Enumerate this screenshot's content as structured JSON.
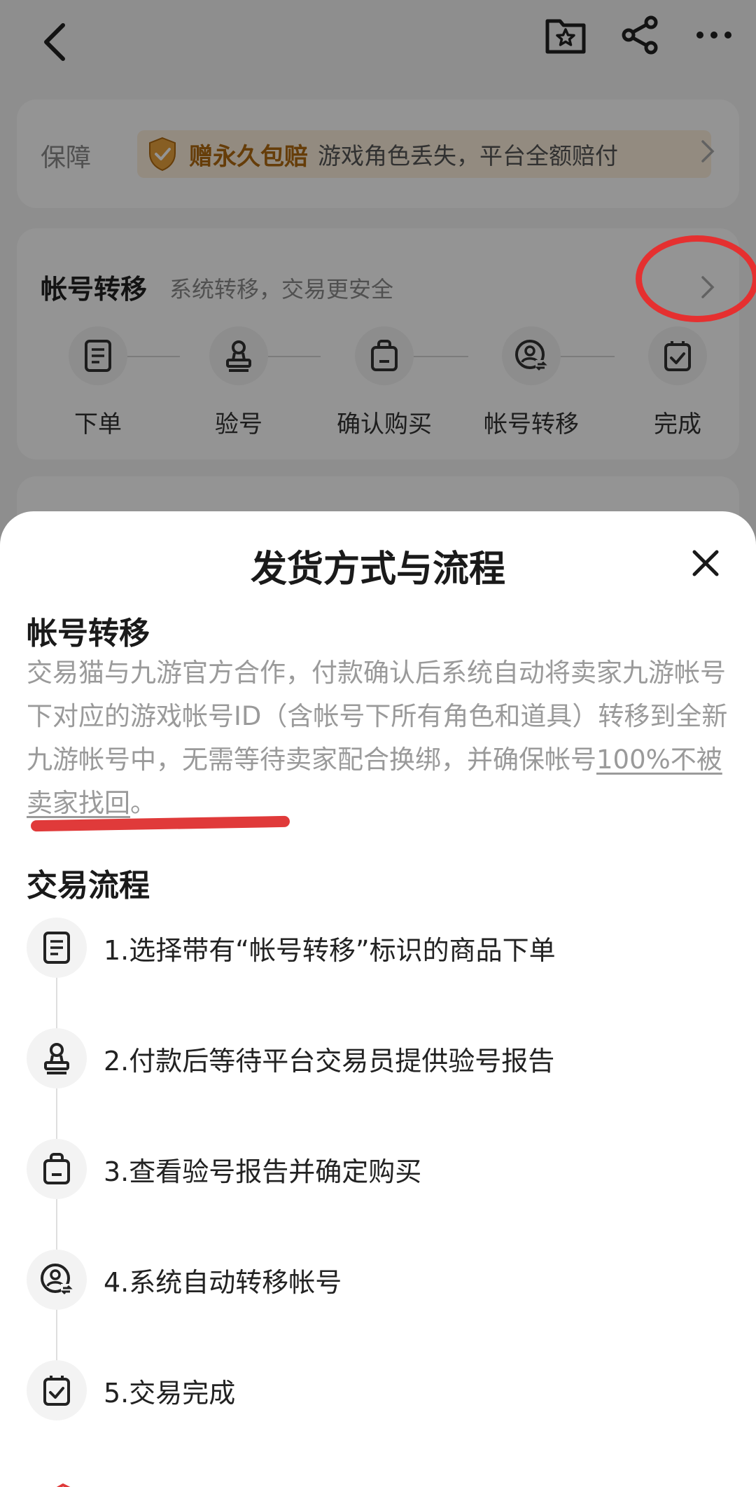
{
  "background": {
    "guarantee": {
      "label": "保障",
      "badge": "赠永久包赔",
      "description": "游戏角色丢失，平台全额赔付"
    },
    "transfer": {
      "title": "帐号转移",
      "subtitle": "系统转移，交易更安全",
      "steps": [
        {
          "label": "下单",
          "icon": "document-icon"
        },
        {
          "label": "验号",
          "icon": "stamp-icon"
        },
        {
          "label": "确认购买",
          "icon": "bag-icon"
        },
        {
          "label": "帐号转移",
          "icon": "user-transfer-icon"
        },
        {
          "label": "完成",
          "icon": "checkbox-icon"
        }
      ]
    }
  },
  "sheet": {
    "title": "发货方式与流程",
    "section1": {
      "title": "帐号转移",
      "body_main": "交易猫与九游官方合作，付款确认后系统自动将卖家九游帐号下对应的游戏帐号ID（含帐号下所有角色和道具）转移到全新九游帐号中，无需等待卖家配合换绑，并确保帐号",
      "body_emphasis": "100%不被卖家找回",
      "body_end": "。"
    },
    "section2": {
      "title": "交易流程",
      "steps": [
        {
          "text": "1.选择带有“帐号转移”标识的商品下单",
          "icon": "document-icon"
        },
        {
          "text": "2.付款后等待平台交易员提供验号报告",
          "icon": "stamp-icon"
        },
        {
          "text": "3.查看验号报告并确定购买",
          "icon": "bag-icon"
        },
        {
          "text": "4.系统自动转移帐号",
          "icon": "user-transfer-icon"
        },
        {
          "text": "5.交易完成",
          "icon": "checkbox-icon"
        }
      ]
    }
  },
  "colors": {
    "annotation_red": "#e53030",
    "badge_bg": "#fdf0dc",
    "badge_text": "#b06a10"
  }
}
